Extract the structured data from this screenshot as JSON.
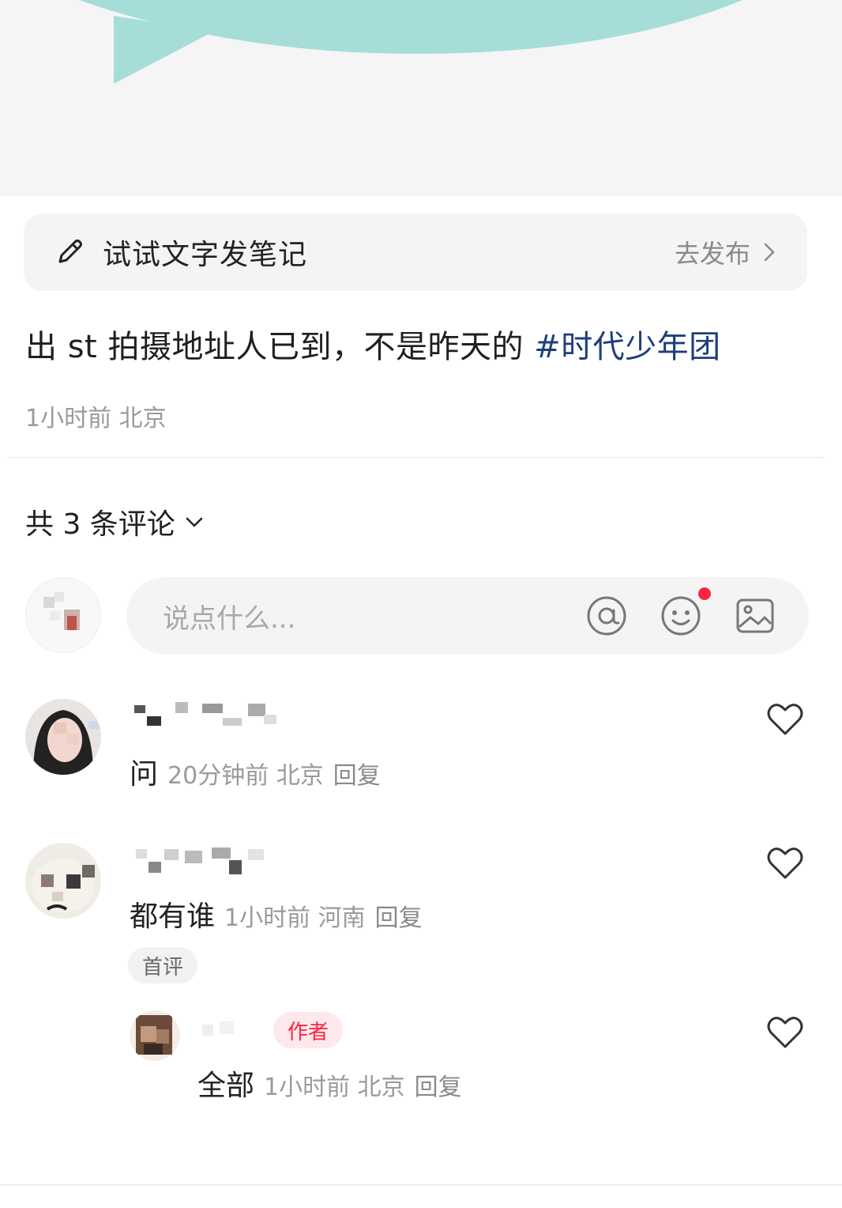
{
  "note_bar": {
    "title": "试试文字发笔记",
    "action": "去发布",
    "icon": "pencil-icon"
  },
  "post": {
    "text": "出 st 拍摄地址人已到，不是昨天的 ",
    "hashtag": "#时代少年团",
    "meta": "1小时前 北京"
  },
  "comments_section": {
    "count_label": "共 3 条评论"
  },
  "comment_input": {
    "placeholder": "说点什么..."
  },
  "comments": [
    {
      "text": "问",
      "meta": "20分钟前 北京",
      "reply": "回复"
    },
    {
      "text": "都有谁",
      "meta": "1小时前 河南",
      "reply": "回复",
      "badge": "首评"
    }
  ],
  "reply": {
    "badge": "作者",
    "text": "全部",
    "meta": "1小时前 北京",
    "reply": "回复"
  },
  "colors": {
    "accent": "#ff2442",
    "hashtag": "#1e3f7a",
    "bubble": "#a6ddd8"
  }
}
